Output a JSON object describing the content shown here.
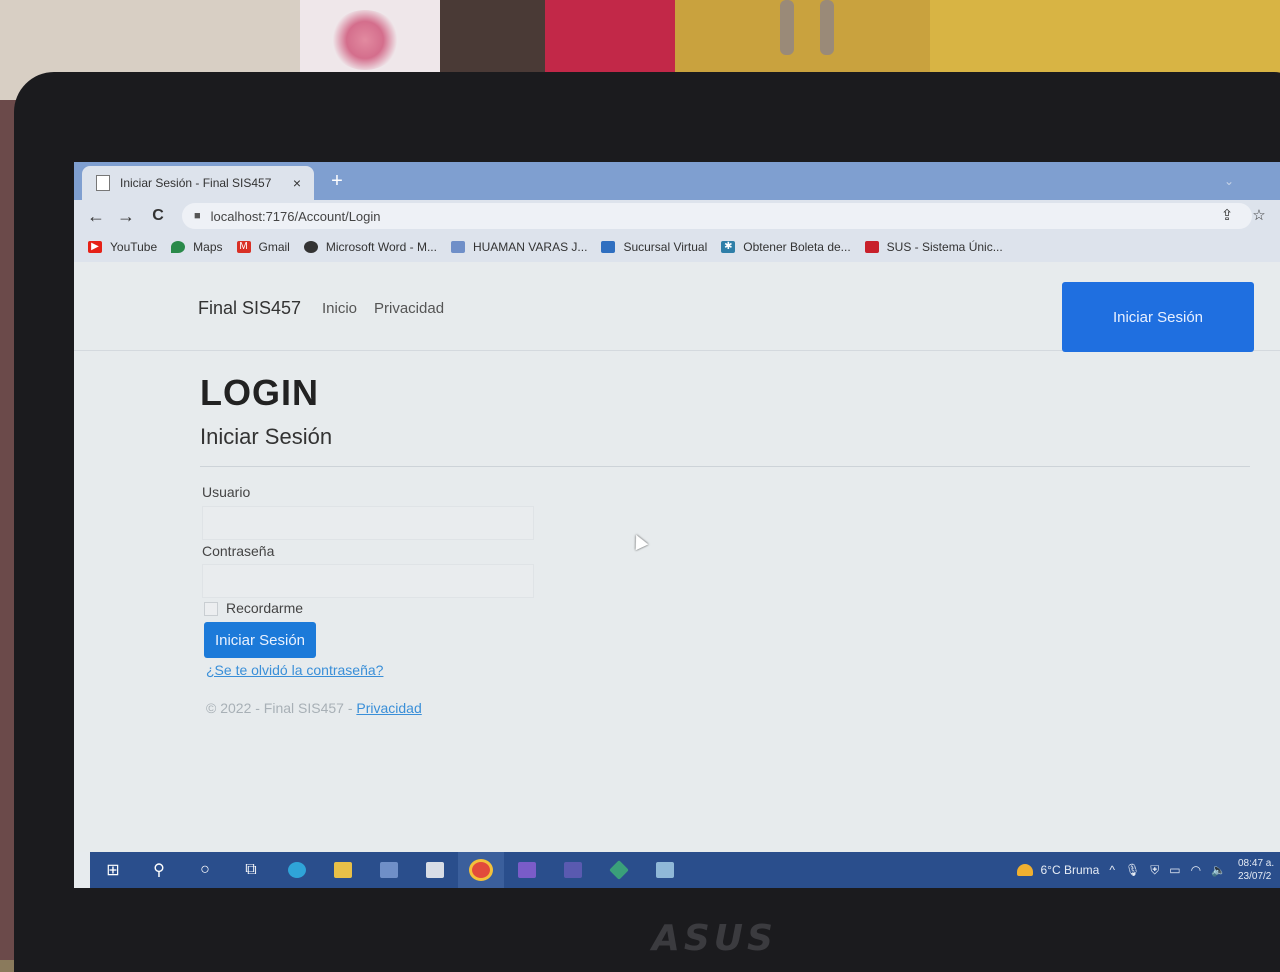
{
  "browser": {
    "tab_title": "Iniciar Sesión - Final SIS457",
    "tab_close": "×",
    "new_tab": "+",
    "tab_menu": "⌄",
    "url": "localhost:7176/Account/Login",
    "icons": {
      "back": "←",
      "forward": "→",
      "reload": "C",
      "lock": "■",
      "share": "⇪",
      "star": "☆"
    },
    "bookmarks": [
      {
        "label": "YouTube",
        "icon": "youtube-icon",
        "color": "#e62117"
      },
      {
        "label": "Maps",
        "icon": "maps-icon",
        "color": "#2a8a4a"
      },
      {
        "label": "Gmail",
        "icon": "gmail-icon",
        "color": "#d93025"
      },
      {
        "label": "Microsoft Word - M...",
        "icon": "globe-icon",
        "color": "#333333"
      },
      {
        "label": "HUAMAN VARAS J...",
        "icon": "doc-icon",
        "color": "#6f8fc8"
      },
      {
        "label": "Sucursal Virtual",
        "icon": "bank-icon",
        "color": "#2f6fc0"
      },
      {
        "label": "Obtener Boleta de...",
        "icon": "gear-icon",
        "color": "#2f7fa8"
      },
      {
        "label": "SUS - Sistema Únic...",
        "icon": "sus-icon",
        "color": "#c8202a"
      }
    ]
  },
  "page": {
    "brand": "Final SIS457",
    "nav": [
      "Inicio",
      "Privacidad"
    ],
    "top_login_button": "Iniciar Sesión",
    "heading": "LOGIN",
    "subheading": "Iniciar Sesión",
    "form": {
      "username_label": "Usuario",
      "password_label": "Contraseña",
      "remember_label": "Recordarme",
      "submit_label": "Iniciar Sesión",
      "forgot_link": "¿Se te olvidó la contraseña?"
    },
    "footer": {
      "text": "© 2022 - Final SIS457 - ",
      "link": "Privacidad"
    }
  },
  "taskbar": {
    "icons": [
      "start-icon",
      "search-icon",
      "cortana-icon",
      "task-view-icon",
      "edge-icon",
      "explorer-icon",
      "store-icon",
      "mail-icon",
      "chrome-icon",
      "visual-studio-icon",
      "app-icon",
      "git-icon",
      "notes-icon"
    ],
    "glyphs": {
      "start": "⊞",
      "search": "⚲",
      "cortana": "○",
      "task_view": "⧉",
      "tray_up": "^",
      "mic": "🎙",
      "shield": "⛨",
      "battery": "▭",
      "wifi": "◠",
      "volume": "🔈"
    },
    "weather": "6°C  Bruma",
    "time": "08:47 a.",
    "date": "23/07/2"
  },
  "device": {
    "brand": "ASUS"
  },
  "colors": {
    "primary_button": "#1f6fe0",
    "taskbar": "#2a4e8c",
    "tabbar": "#7f9fd0"
  }
}
